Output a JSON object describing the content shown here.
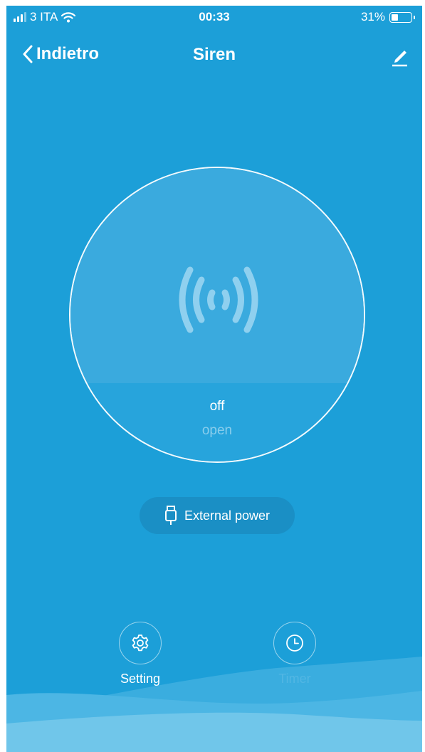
{
  "status_bar": {
    "carrier": "3 ITA",
    "time": "00:33",
    "battery_percent": "31%",
    "battery_level": 0.31
  },
  "nav": {
    "back_label": "Indietro",
    "title": "Siren",
    "edit_icon": "pencil-icon"
  },
  "device": {
    "icon": "siren-waves-icon",
    "state": "off",
    "action": "open"
  },
  "power": {
    "icon": "usb-plug-icon",
    "label": "External power"
  },
  "actions": [
    {
      "label": "Setting",
      "icon": "gear-icon"
    },
    {
      "label": "Timer",
      "icon": "clock-icon"
    }
  ],
  "colors": {
    "background": "#1c9fd8",
    "circle_upper": "#3aaade",
    "pill": "#1a8fc5",
    "wave_light": "#70c6ea"
  }
}
